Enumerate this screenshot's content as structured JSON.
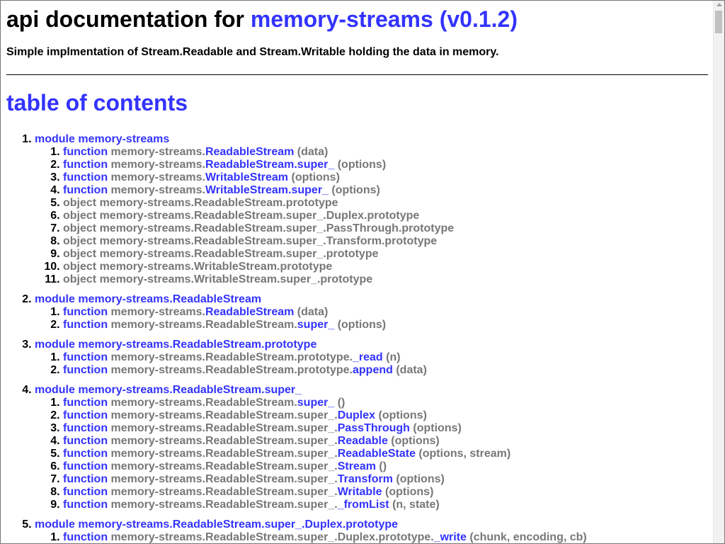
{
  "header": {
    "title_prefix": "api documentation for ",
    "package_link": "memory-streams (v0.1.2)",
    "description": "Simple implmentation of Stream.Readable and Stream.Writable holding the data in memory."
  },
  "toc": {
    "title": "table of contents",
    "modules": [
      {
        "label": "module memory-streams",
        "entries": [
          {
            "kind": "function",
            "prefix": "memory-streams.",
            "name": "ReadableStream",
            "args": "(data)"
          },
          {
            "kind": "function",
            "prefix": "memory-streams.",
            "name": "ReadableStream.super_",
            "args": "(options)"
          },
          {
            "kind": "function",
            "prefix": "memory-streams.",
            "name": "WritableStream",
            "args": "(options)"
          },
          {
            "kind": "function",
            "prefix": "memory-streams.",
            "name": "WritableStream.super_",
            "args": "(options)"
          },
          {
            "kind": "object",
            "text": "object memory-streams.ReadableStream.prototype"
          },
          {
            "kind": "object",
            "text": "object memory-streams.ReadableStream.super_.Duplex.prototype"
          },
          {
            "kind": "object",
            "text": "object memory-streams.ReadableStream.super_.PassThrough.prototype"
          },
          {
            "kind": "object",
            "text": "object memory-streams.ReadableStream.super_.Transform.prototype"
          },
          {
            "kind": "object",
            "text": "object memory-streams.ReadableStream.super_.prototype"
          },
          {
            "kind": "object",
            "text": "object memory-streams.WritableStream.prototype"
          },
          {
            "kind": "object",
            "text": "object memory-streams.WritableStream.super_.prototype"
          }
        ]
      },
      {
        "label": "module memory-streams.ReadableStream",
        "entries": [
          {
            "kind": "function",
            "prefix": "memory-streams.",
            "name": "ReadableStream",
            "args": "(data)"
          },
          {
            "kind": "function",
            "prefix": "memory-streams.ReadableStream.",
            "name": "super_",
            "args": "(options)"
          }
        ]
      },
      {
        "label": "module memory-streams.ReadableStream.prototype",
        "entries": [
          {
            "kind": "function",
            "prefix": "memory-streams.ReadableStream.prototype.",
            "name": "_read",
            "args": "(n)"
          },
          {
            "kind": "function",
            "prefix": "memory-streams.ReadableStream.prototype.",
            "name": "append",
            "args": "(data)"
          }
        ]
      },
      {
        "label": "module memory-streams.ReadableStream.super_",
        "entries": [
          {
            "kind": "function",
            "prefix": "memory-streams.ReadableStream.",
            "name": "super_",
            "args": "()"
          },
          {
            "kind": "function",
            "prefix": "memory-streams.ReadableStream.super_.",
            "name": "Duplex",
            "args": "(options)"
          },
          {
            "kind": "function",
            "prefix": "memory-streams.ReadableStream.super_.",
            "name": "PassThrough",
            "args": "(options)"
          },
          {
            "kind": "function",
            "prefix": "memory-streams.ReadableStream.super_.",
            "name": "Readable",
            "args": "(options)"
          },
          {
            "kind": "function",
            "prefix": "memory-streams.ReadableStream.super_.",
            "name": "ReadableState",
            "args": "(options, stream)"
          },
          {
            "kind": "function",
            "prefix": "memory-streams.ReadableStream.super_.",
            "name": "Stream",
            "args": "()"
          },
          {
            "kind": "function",
            "prefix": "memory-streams.ReadableStream.super_.",
            "name": "Transform",
            "args": "(options)"
          },
          {
            "kind": "function",
            "prefix": "memory-streams.ReadableStream.super_.",
            "name": "Writable",
            "args": "(options)"
          },
          {
            "kind": "function",
            "prefix": "memory-streams.ReadableStream.super_.",
            "name": "_fromList",
            "args": "(n, state)"
          }
        ]
      },
      {
        "label": "module memory-streams.ReadableStream.super_.Duplex.prototype",
        "entries": [
          {
            "kind": "function",
            "prefix": "memory-streams.ReadableStream.super_.Duplex.prototype.",
            "name": "_write",
            "args": "(chunk, encoding, cb)"
          }
        ]
      }
    ]
  },
  "keyword_function": "function",
  "colors": {
    "link": "#3333ff",
    "muted": "#777777",
    "text": "#000000"
  }
}
